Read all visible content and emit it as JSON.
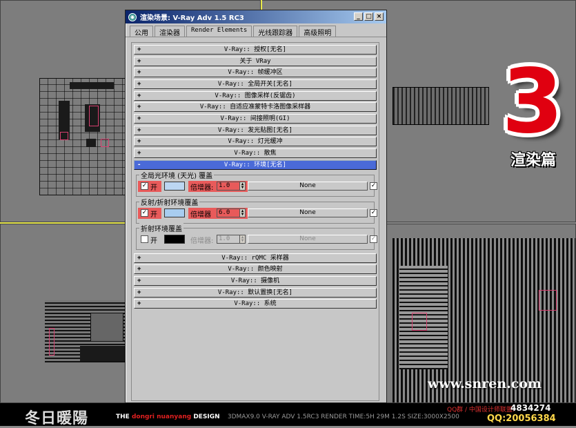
{
  "window": {
    "title": "渲染场景: V-Ray Adv 1.5 RC3",
    "controls": [
      "_",
      "□",
      "×"
    ]
  },
  "tabs": [
    "公用",
    "渲染器",
    "Render Elements",
    "光线跟踪器",
    "高级照明"
  ],
  "rollouts_top": [
    {
      "sign": "+",
      "label": "V-Ray:: 授权[无名]"
    },
    {
      "sign": "+",
      "label": "关于 VRay"
    },
    {
      "sign": "+",
      "label": "V-Ray:: 帧缓冲区"
    },
    {
      "sign": "+",
      "label": "V-Ray:: 全局开关[无名]"
    },
    {
      "sign": "+",
      "label": "V-Ray:: 图像采样(反锯齿)"
    },
    {
      "sign": "+",
      "label": "V-Ray:: 自适应准蒙特卡洛图像采样器"
    },
    {
      "sign": "+",
      "label": "V-Ray:: 间接照明(GI)"
    },
    {
      "sign": "+",
      "label": "V-Ray:: 发光贴图[无名]"
    },
    {
      "sign": "+",
      "label": "V-Ray:: 灯光缓冲"
    },
    {
      "sign": "+",
      "label": "V-Ray:: 散焦"
    }
  ],
  "open_rollout": {
    "sign": "-",
    "label": "V-Ray:: 环境[无名]"
  },
  "environment": {
    "gi": {
      "title": "全局光环境 (天光) 覆盖",
      "check": "✓",
      "on_label": "开",
      "mult_label": "倍增器:",
      "mult_value": "1.0",
      "map": "None",
      "map_check": "✓",
      "color": "#bcd6f2"
    },
    "refl": {
      "title": "反射/折射环境覆盖",
      "check": "✓",
      "on_label": "开",
      "mult_label": "倍增器",
      "mult_value": "6.0",
      "map": "None",
      "map_check": "✓",
      "color": "#a8cdf0"
    },
    "refr": {
      "title": "折射环境覆盖",
      "check": "",
      "on_label": "开",
      "mult_label": "倍增器:",
      "mult_value": "1.0",
      "map": "None",
      "map_check": "✓",
      "color": "#000000"
    }
  },
  "rollouts_bottom": [
    {
      "sign": "+",
      "label": "V-Ray:: rQMC 采样器"
    },
    {
      "sign": "+",
      "label": "V-Ray:: 颜色映射"
    },
    {
      "sign": "+",
      "label": "V-Ray:: 摄像机"
    },
    {
      "sign": "+",
      "label": "V-Ray:: 默认置换[无名]"
    },
    {
      "sign": "+",
      "label": "V-Ray:: 系统"
    }
  ],
  "overlay": {
    "number": "3",
    "chapter": "渲染篇",
    "website": "www.snren.com"
  },
  "footer": {
    "brand": "冬日暖陽",
    "design_prefix": "THE",
    "design_red": "dongri nuanyang",
    "design_suffix": "DESIGN",
    "specs": "3DMAX9.0  V-RAY ADV 1.5RC3   RENDER TIME:5H 29M 1.2S  SIZE:3000X2500",
    "qq_label": "QQ群 / 中国设计师联盟:",
    "qq_group": "4834274",
    "qq_personal": "QQ:20056384"
  },
  "colors": {
    "highlight": "#e85a5a",
    "open_rollout": "#4a6ad8",
    "big_number": "#e00010"
  }
}
